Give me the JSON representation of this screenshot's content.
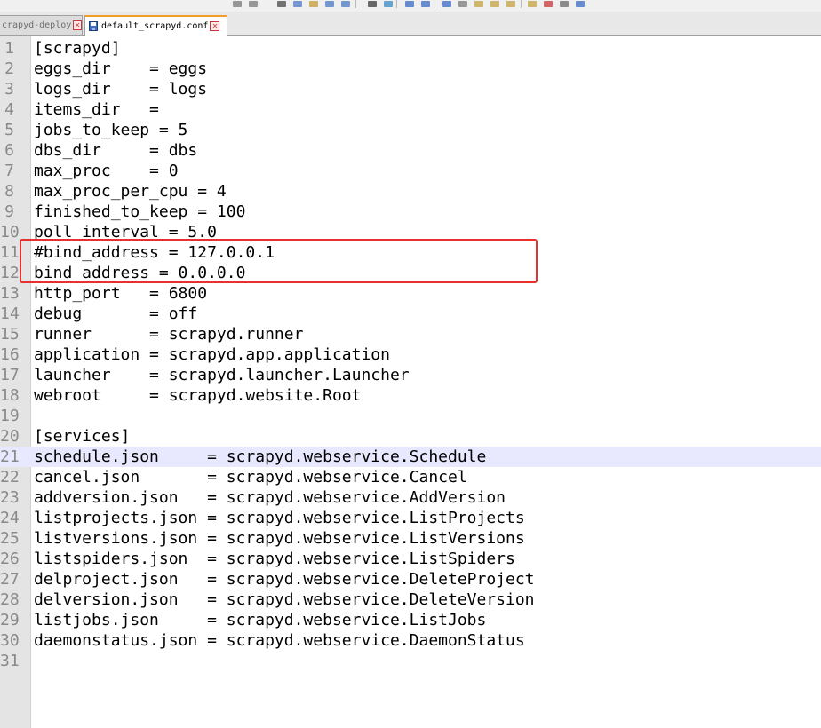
{
  "toolbar": {
    "icons": [
      "find-icon",
      "replace-icon",
      "cut-icon",
      "copy-icon",
      "paste-icon",
      "undo-icon",
      "redo-icon",
      "print-icon",
      "sync-icon",
      "zoom-in-icon",
      "zoom-out-icon",
      "sync-scroll-icon",
      "wrap-icon",
      "indent-icon",
      "fold-icon",
      "monitor-icon",
      "macro-record-icon",
      "macro-stop-icon",
      "macro-play-icon",
      "macro-save-icon"
    ]
  },
  "tabs": [
    {
      "label": "crapyd-deploy",
      "active": false
    },
    {
      "label": "default_scrapyd.conf",
      "active": true
    }
  ],
  "editor": {
    "current_line": 21,
    "lines": [
      {
        "num": "1",
        "text": "[scrapyd]"
      },
      {
        "num": "2",
        "text": "eggs_dir    = eggs"
      },
      {
        "num": "3",
        "text": "logs_dir    = logs"
      },
      {
        "num": "4",
        "text": "items_dir   ="
      },
      {
        "num": "5",
        "text": "jobs_to_keep = 5"
      },
      {
        "num": "6",
        "text": "dbs_dir     = dbs"
      },
      {
        "num": "7",
        "text": "max_proc    = 0"
      },
      {
        "num": "8",
        "text": "max_proc_per_cpu = 4"
      },
      {
        "num": "9",
        "text": "finished_to_keep = 100"
      },
      {
        "num": "10",
        "text": "poll_interval = 5.0"
      },
      {
        "num": "11",
        "text": "#bind_address = 127.0.0.1"
      },
      {
        "num": "12",
        "text": "bind_address = 0.0.0.0"
      },
      {
        "num": "13",
        "text": "http_port   = 6800"
      },
      {
        "num": "14",
        "text": "debug       = off"
      },
      {
        "num": "15",
        "text": "runner      = scrapyd.runner"
      },
      {
        "num": "16",
        "text": "application = scrapyd.app.application"
      },
      {
        "num": "17",
        "text": "launcher    = scrapyd.launcher.Launcher"
      },
      {
        "num": "18",
        "text": "webroot     = scrapyd.website.Root"
      },
      {
        "num": "19",
        "text": ""
      },
      {
        "num": "20",
        "text": "[services]"
      },
      {
        "num": "21",
        "text": "schedule.json     = scrapyd.webservice.Schedule"
      },
      {
        "num": "22",
        "text": "cancel.json       = scrapyd.webservice.Cancel"
      },
      {
        "num": "23",
        "text": "addversion.json   = scrapyd.webservice.AddVersion"
      },
      {
        "num": "24",
        "text": "listprojects.json = scrapyd.webservice.ListProjects"
      },
      {
        "num": "25",
        "text": "listversions.json = scrapyd.webservice.ListVersions"
      },
      {
        "num": "26",
        "text": "listspiders.json  = scrapyd.webservice.ListSpiders"
      },
      {
        "num": "27",
        "text": "delproject.json   = scrapyd.webservice.DeleteProject"
      },
      {
        "num": "28",
        "text": "delversion.json   = scrapyd.webservice.DeleteVersion"
      },
      {
        "num": "29",
        "text": "listjobs.json     = scrapyd.webservice.ListJobs"
      },
      {
        "num": "30",
        "text": "daemonstatus.json = scrapyd.webservice.DaemonStatus"
      },
      {
        "num": "31",
        "text": ""
      }
    ]
  },
  "colors": {
    "highlight_border": "#e8312d",
    "current_line": "#e8e8ff",
    "active_tab_accent": "#f39c27"
  }
}
